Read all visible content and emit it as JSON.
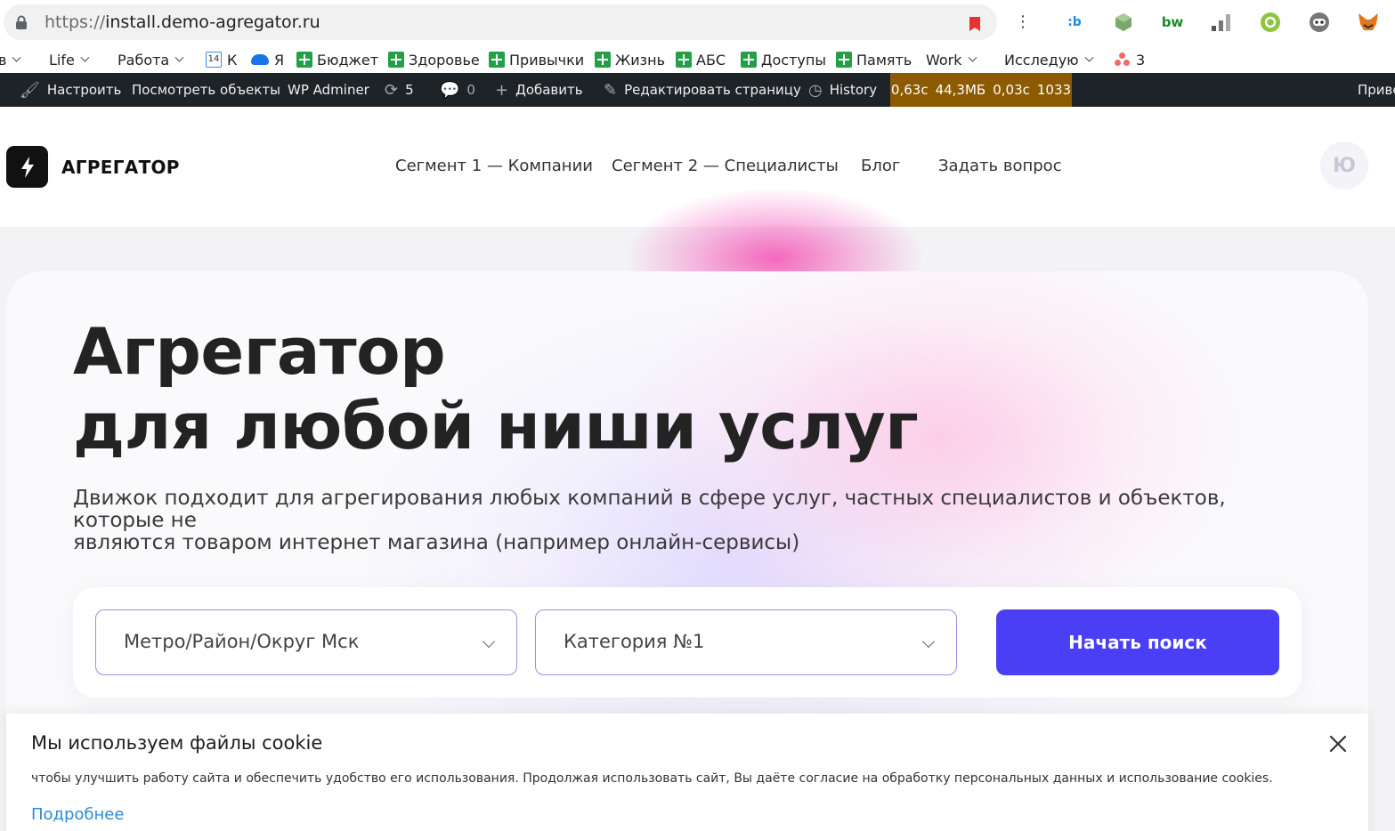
{
  "browser": {
    "url_protocol": "https://",
    "url_host": "install.demo-agregator.ru",
    "extensions": [
      "blue-b-extension-icon",
      "green-cube-extension-icon",
      "bw-extension-icon",
      "signal-bars-extension-icon",
      "green-gear-extension-icon",
      "robot-extension-icon",
      "fox-extension-icon"
    ],
    "ext_bw_label": "bw"
  },
  "bookmarks": {
    "first_partial": "в",
    "life": "Life",
    "rabota": "Работа",
    "k": "К",
    "ya": "Я",
    "budget": "Бюджет",
    "health": "Здоровье",
    "habits": "Привычки",
    "life_ru": "Жизнь",
    "abs": "АБС",
    "access": "Доступы",
    "memory": "Память",
    "work": "Work",
    "research": "Исследую",
    "three": "3",
    "calendar_num": "14"
  },
  "wpbar": {
    "customize": "Настроить",
    "view_objects": "Посмотреть объекты",
    "wp_adminer": "WP Adminer",
    "updates_count": "5",
    "comments_count": "0",
    "add": "Добавить",
    "edit_page": "Редактировать страницу",
    "history": "History",
    "perf_time": "0,63с",
    "perf_mem": "44,3МБ",
    "perf_query_time": "0,03с",
    "perf_queries": "1033",
    "right_partial": "Приве"
  },
  "header": {
    "logo_text": "АГРЕГАТОР",
    "nav": [
      "Сегмент 1 — Компании",
      "Сегмент 2 — Специалисты",
      "Блог",
      "Задать вопрос"
    ],
    "avatar_letter": "Ю"
  },
  "hero": {
    "title_line1": "Агрегатор",
    "title_line2": "для любой ниши услуг",
    "subtitle_line1": "Движок подходит для агрегирования любых компаний в сфере услуг, частных специалистов и объектов, которые не",
    "subtitle_line2": "являются товаром интернет магазина (например онлайн-сервисы)",
    "location_select": "Метро/Район/Округ Мск",
    "category_select": "Категория №1",
    "search_button": "Начать поиск"
  },
  "cookie": {
    "title": "Мы используем файлы cookie",
    "text": "чтобы улучшить работу сайта и обеспечить удобство его использования. Продолжая использовать сайт, Вы даёте согласие на обработку персональных данных и использование cookies.",
    "more_link": "Подробнее"
  },
  "colors": {
    "accent": "#4a3ff5",
    "wp_bar": "#1d2327",
    "perf_bg": "#8c5a00",
    "link": "#2d8bd8",
    "bookmark_green": "#23a046"
  }
}
